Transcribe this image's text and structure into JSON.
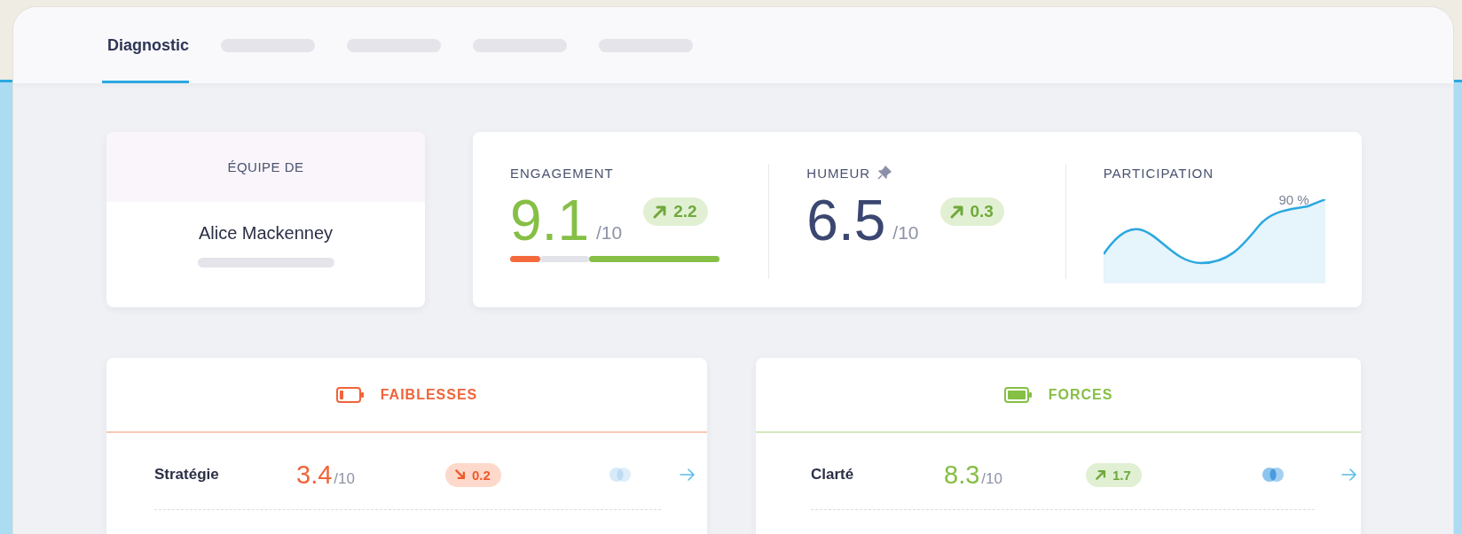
{
  "tabs": [
    {
      "kind": "label",
      "label": "Diagnostic",
      "selected": true
    },
    {
      "kind": "placeholder",
      "selected": false
    },
    {
      "kind": "placeholder",
      "selected": false
    },
    {
      "kind": "placeholder",
      "selected": false
    },
    {
      "kind": "placeholder",
      "selected": false
    }
  ],
  "team": {
    "heading": "ÉQUIPE DE",
    "name": "Alice Mackenney"
  },
  "metrics": [
    {
      "kind": "score",
      "label": "ENGAGEMENT",
      "pinned": false,
      "value": "9.1",
      "scale": "/10",
      "color": "#86bf45",
      "trend": {
        "kind": "up",
        "value": "2.2"
      },
      "distribution": [
        {
          "color": "#f46a3c"
        },
        {
          "color": "#e2e3e8"
        },
        {
          "color": "#86bf45"
        }
      ]
    },
    {
      "kind": "score",
      "label": "HUMEUR",
      "pinned": true,
      "value": "6.5",
      "scale": "/10",
      "color": "#3b4770",
      "trend": {
        "kind": "up",
        "value": "0.3"
      }
    },
    {
      "kind": "sparkline",
      "label": "PARTICIPATION",
      "peak_label": "90 %"
    }
  ],
  "panels": [
    {
      "kind": "weak",
      "title": "FAIBLESSES",
      "rows": [
        {
          "name": "Stratégie",
          "value": "3.4",
          "scale": "/10",
          "trend": {
            "kind": "down",
            "value": "0.2"
          },
          "compare_active": false
        }
      ]
    },
    {
      "kind": "strong",
      "title": "FORCES",
      "rows": [
        {
          "name": "Clarté",
          "value": "8.3",
          "scale": "/10",
          "trend": {
            "kind": "up",
            "value": "1.7"
          },
          "compare_active": true
        }
      ]
    }
  ]
}
